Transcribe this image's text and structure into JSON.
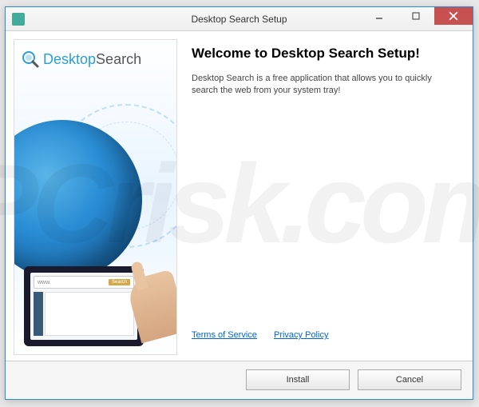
{
  "window": {
    "title": "Desktop Search Setup"
  },
  "sidebar": {
    "logo_part1": "Desktop",
    "logo_part2": "Search",
    "tablet_url": "www.",
    "tablet_search": "Search"
  },
  "main": {
    "heading": "Welcome to Desktop Search Setup!",
    "description": "Desktop Search is a free application that allows you to quickly search the web from your system tray!"
  },
  "links": {
    "terms": "Terms of Service",
    "privacy": "Privacy Policy"
  },
  "buttons": {
    "install": "Install",
    "cancel": "Cancel"
  },
  "watermark": "PCrisk.com"
}
